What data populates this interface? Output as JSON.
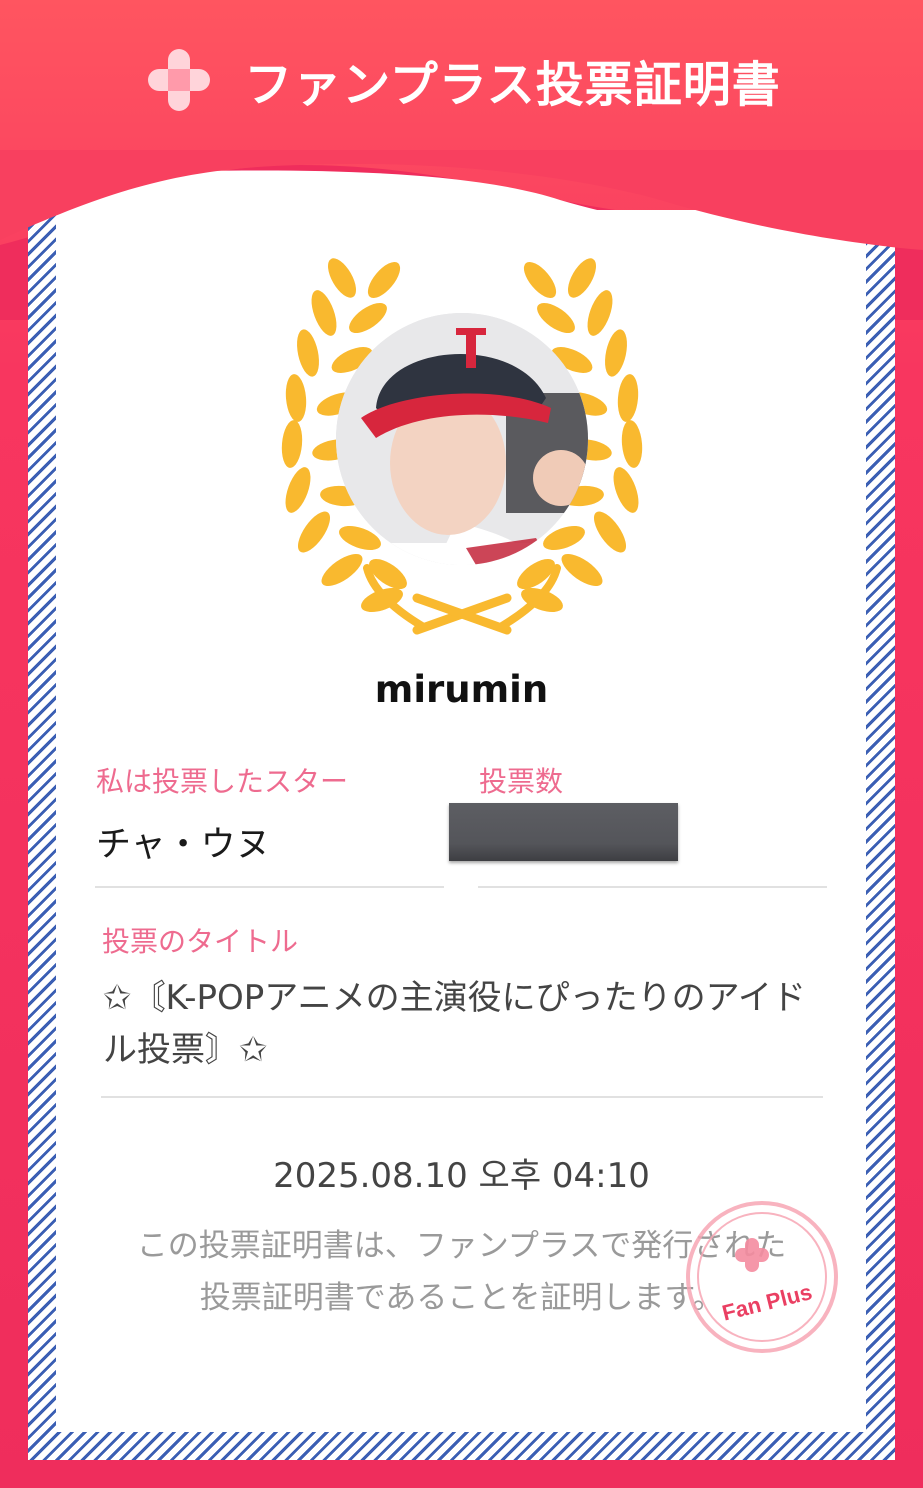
{
  "header": {
    "title": "ファンプラス投票証明書"
  },
  "profile": {
    "username": "mirumin"
  },
  "star": {
    "label": "私は投票したスター",
    "name": "チャ・ウヌ"
  },
  "votes": {
    "label": "投票数",
    "value": ""
  },
  "vote_title": {
    "label": "投票のタイトル",
    "text": "✩〘K-POPアニメの主演役にぴったりのアイドル投票〙✩"
  },
  "timestamp": "2025.08.10 오후 04:10",
  "notice": {
    "line1": "この投票証明書は、ファンプラスで発行された",
    "line2": "投票証明書であることを証明します。"
  },
  "stamp": {
    "text": "Fan Plus"
  },
  "colors": {
    "brand_pink": "#ef2d5c",
    "label_pink": "#ee6b8f",
    "laurel_gold": "#f9b92f",
    "border_blue": "#3b5fb4"
  }
}
